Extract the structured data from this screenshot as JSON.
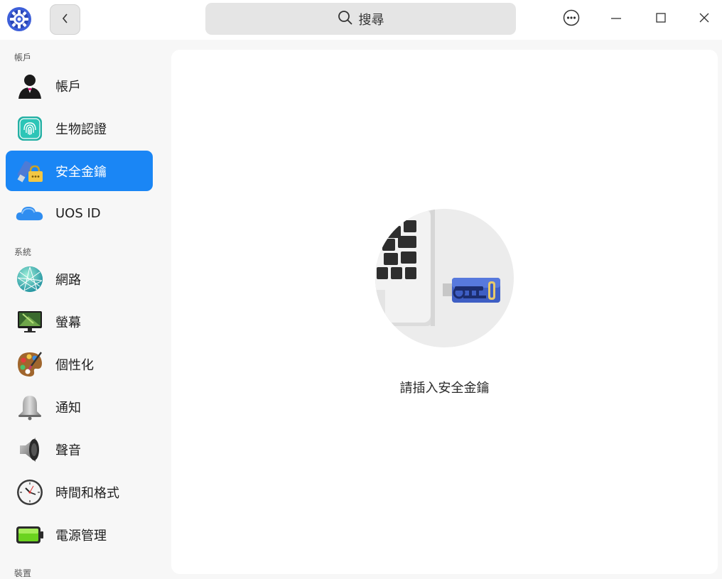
{
  "header": {
    "search_label": "搜尋"
  },
  "sidebar": {
    "sections": [
      {
        "label": "帳戶"
      },
      {
        "label": "系統"
      },
      {
        "label": "裝置"
      }
    ],
    "items": [
      {
        "label": "帳戶",
        "icon": "user-icon"
      },
      {
        "label": "生物認證",
        "icon": "fingerprint-icon"
      },
      {
        "label": "安全金鑰",
        "icon": "security-key-icon",
        "active": true
      },
      {
        "label": "UOS ID",
        "icon": "cloud-icon"
      },
      {
        "label": "網路",
        "icon": "network-globe-icon"
      },
      {
        "label": "螢幕",
        "icon": "monitor-icon"
      },
      {
        "label": "個性化",
        "icon": "palette-icon"
      },
      {
        "label": "通知",
        "icon": "bell-icon"
      },
      {
        "label": "聲音",
        "icon": "speaker-icon"
      },
      {
        "label": "時間和格式",
        "icon": "clock-icon"
      },
      {
        "label": "電源管理",
        "icon": "battery-icon"
      }
    ]
  },
  "main": {
    "prompt": "請插入安全金鑰"
  },
  "colors": {
    "accent": "#1a86f5",
    "window_bg": "#f7f7f7",
    "panel_bg": "#ffffff"
  }
}
